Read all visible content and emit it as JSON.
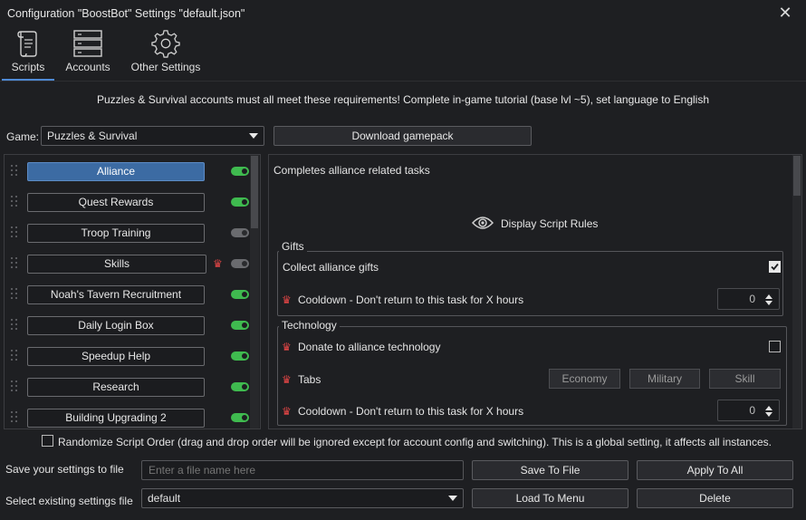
{
  "window": {
    "title": "Configuration \"BoostBot\" Settings \"default.json\"",
    "close_icon": "close-icon"
  },
  "tabs": [
    {
      "label": "Scripts",
      "icon": "scroll-icon",
      "active": true
    },
    {
      "label": "Accounts",
      "icon": "server-list-icon",
      "active": false
    },
    {
      "label": "Other Settings",
      "icon": "gear-icon",
      "active": false
    }
  ],
  "notice": "Puzzles & Survival accounts must all meet these requirements! Complete in-game tutorial (base lvl ~5), set language to English",
  "game": {
    "label": "Game:",
    "selected": "Puzzles & Survival",
    "download_label": "Download gamepack"
  },
  "scripts": [
    {
      "name": "Alliance",
      "enabled": true,
      "active": true,
      "premium": false
    },
    {
      "name": "Quest Rewards",
      "enabled": true,
      "active": false,
      "premium": false
    },
    {
      "name": "Troop Training",
      "enabled": false,
      "active": false,
      "premium": false
    },
    {
      "name": "Skills",
      "enabled": false,
      "active": false,
      "premium": true
    },
    {
      "name": "Noah's Tavern Recruitment",
      "enabled": true,
      "active": false,
      "premium": false
    },
    {
      "name": "Daily Login Box",
      "enabled": true,
      "active": false,
      "premium": false
    },
    {
      "name": "Speedup Help",
      "enabled": true,
      "active": false,
      "premium": false
    },
    {
      "name": "Research",
      "enabled": true,
      "active": false,
      "premium": false
    },
    {
      "name": "Building Upgrading 2",
      "enabled": true,
      "active": false,
      "premium": false
    }
  ],
  "details": {
    "description": "Completes alliance related tasks",
    "display_rules_label": "Display Script Rules",
    "gifts": {
      "title": "Gifts",
      "collect_label": "Collect alliance gifts",
      "collect_checked": true,
      "cooldown_label": "Cooldown - Don't return to this task for X hours",
      "cooldown_value": "0"
    },
    "technology": {
      "title": "Technology",
      "donate_label": "Donate to alliance technology",
      "donate_checked": false,
      "tabs_label": "Tabs",
      "tab_options": [
        "Economy",
        "Military",
        "Skill"
      ],
      "cooldown_label": "Cooldown - Don't return to this task for X hours",
      "cooldown_value": "0"
    }
  },
  "footer": {
    "randomize_label": "Randomize Script Order (drag and drop order will be ignored except for account config and switching). This is a global setting, it affects all instances.",
    "randomize_checked": false,
    "save_label": "Save your settings to file",
    "save_placeholder": "Enter a file name here",
    "save_button": "Save To File",
    "apply_button": "Apply To All",
    "select_label": "Select existing settings file",
    "select_value": "default",
    "load_button": "Load To Menu",
    "delete_button": "Delete"
  },
  "colors": {
    "accent": "#4f8ad4",
    "toggle_on": "#3fba4f",
    "premium_crown": "#e04545",
    "background": "#1e1f22"
  }
}
